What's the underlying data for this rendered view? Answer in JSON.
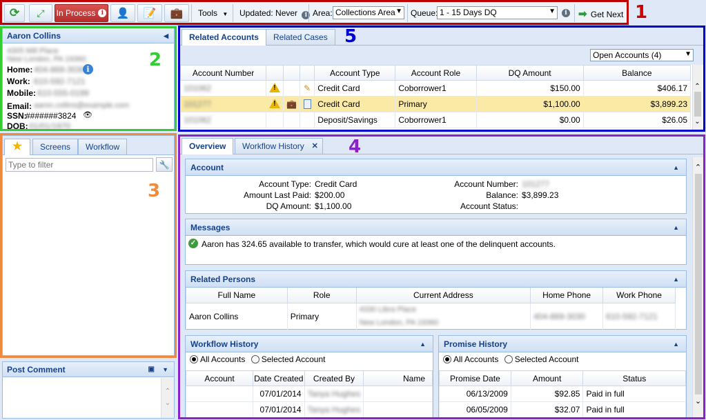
{
  "toolbar": {
    "in_process_label": "In Process",
    "tools_label": "Tools",
    "updated_label": "Updated: Never",
    "area_label": "Area:",
    "area_value": "Collections Area",
    "queue_label": "Queue:",
    "queue_value": "1 - 15 Days DQ",
    "get_next_label": "Get Next"
  },
  "markers": {
    "m1": "1",
    "m2": "2",
    "m3": "3",
    "m4": "4",
    "m5": "5"
  },
  "customer": {
    "name": "Aaron Collins",
    "address1": "4305 Mill Place",
    "address2": "New London, PA 19360",
    "home_label": "Home:",
    "home_value": "404-869-3030",
    "work_label": "Work:",
    "work_value": "610-592-7121",
    "mobile_label": "Mobile:",
    "mobile_value": "610-555-0199",
    "email_label": "Email:",
    "email_value": "aaron.collins@example.com",
    "ssn_label": "SSN:",
    "ssn_value": "#######3824",
    "dob_label": "DOB:",
    "dob_value": "01/01/1970"
  },
  "side_tabs": {
    "screens": "Screens",
    "workflow": "Workflow",
    "filter_placeholder": "Type to filter"
  },
  "post_comment": {
    "title": "Post Comment"
  },
  "related": {
    "tab_accounts": "Related Accounts",
    "tab_cases": "Related Cases",
    "filter_value": "Open Accounts (4)",
    "columns": [
      "Account Number",
      "Account Type",
      "Account Role",
      "DQ Amount",
      "Balance"
    ],
    "rows": [
      {
        "number": "101062",
        "type": "Credit Card",
        "role": "Coborrower1",
        "dq": "$150.00",
        "balance": "$406.17"
      },
      {
        "number": "101277",
        "type": "Credit Card",
        "role": "Primary",
        "dq": "$1,100.00",
        "balance": "$3,899.23"
      },
      {
        "number": "101062",
        "type": "Deposit/Savings",
        "role": "Coborrower1",
        "dq": "$0.00",
        "balance": "$26.05"
      }
    ]
  },
  "main_tabs": {
    "overview": "Overview",
    "workflow_history": "Workflow History"
  },
  "account": {
    "title": "Account",
    "type_label": "Account Type:",
    "type_value": "Credit Card",
    "last_paid_label": "Amount Last Paid:",
    "last_paid_value": "$200.00",
    "dq_label": "DQ Amount:",
    "dq_value": "$1,100.00",
    "number_label": "Account Number:",
    "number_value": "101277",
    "balance_label": "Balance:",
    "balance_value": "$3,899.23",
    "status_label": "Account Status:"
  },
  "messages": {
    "title": "Messages",
    "text": "Aaron has 324.65 available to transfer, which would cure at least one of the delinquent accounts."
  },
  "persons": {
    "title": "Related Persons",
    "columns": [
      "Full Name",
      "Role",
      "Current Address",
      "Home Phone",
      "Work Phone"
    ],
    "row": {
      "name": "Aaron Collins",
      "role": "Primary",
      "addr1": "4330 Libra Place",
      "addr2": "New London, PA 19360",
      "home": "404-869-3030",
      "work": "610-592-7121"
    }
  },
  "workflow_history": {
    "title": "Workflow History",
    "all_label": "All Accounts",
    "selected_label": "Selected Account",
    "columns": [
      "Account",
      "Date Created",
      "Created By",
      "Name"
    ],
    "rows": [
      {
        "date": "07/01/2014",
        "by": "Tanya Hughes"
      },
      {
        "date": "07/01/2014",
        "by": "Tanya Hughes"
      }
    ]
  },
  "promise_history": {
    "title": "Promise History",
    "all_label": "All Accounts",
    "selected_label": "Selected Account",
    "columns": [
      "Promise Date",
      "Amount",
      "Status"
    ],
    "rows": [
      {
        "date": "06/13/2009",
        "amount": "$92.85",
        "status": "Paid in full"
      },
      {
        "date": "06/05/2009",
        "amount": "$32.07",
        "status": "Paid in full"
      }
    ]
  },
  "colors": {
    "red": "#c00000",
    "green": "#33cc33",
    "orange": "#f08a3c",
    "blue": "#0000cc",
    "purple": "#8b22c8",
    "accent": "#15428b"
  }
}
